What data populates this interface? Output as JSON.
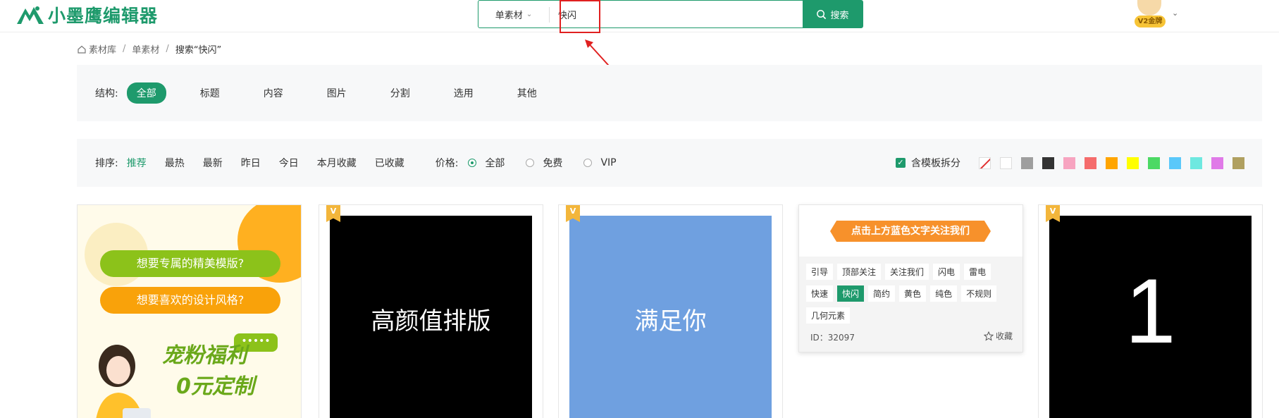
{
  "header": {
    "logo_text": "小墨鹰编辑器",
    "search": {
      "category": "单素材",
      "query": "快闪",
      "button": "搜索"
    },
    "user_badge": "V2金牌"
  },
  "breadcrumb": {
    "items": [
      "素材库",
      "单素材"
    ],
    "current": "搜索“快闪”"
  },
  "structure": {
    "label": "结构:",
    "options": [
      "全部",
      "标题",
      "内容",
      "图片",
      "分割",
      "选用",
      "其他"
    ],
    "active": "全部"
  },
  "sort": {
    "label": "排序:",
    "options": [
      "推荐",
      "最热",
      "最新",
      "昨日",
      "今日",
      "本月收藏",
      "已收藏"
    ],
    "active": "推荐"
  },
  "price": {
    "label": "价格:",
    "options": [
      "全部",
      "免费",
      "VIP"
    ],
    "selected": "全部"
  },
  "template_split": {
    "label": "含模板拆分",
    "checked": true
  },
  "colors": [
    "none",
    "#ffffff",
    "#9e9e9e",
    "#333333",
    "#f7a4c0",
    "#f56c6c",
    "#ffa500",
    "#ffff00",
    "#4cd964",
    "#5ac8fa",
    "#6ee8e0",
    "#e07ae8",
    "#b0a060"
  ],
  "cards": [
    {
      "type": "promo",
      "pill1": "想要专属的精美模版?",
      "pill2": "想要喜欢的设计风格?",
      "headline1": "宠粉福利",
      "headline2": "0元定制",
      "bubble": "•••••"
    },
    {
      "type": "text",
      "vip": true,
      "bg": "black",
      "text": "高颜值排版"
    },
    {
      "type": "text",
      "vip": true,
      "bg": "blue",
      "text": "满足你"
    },
    {
      "type": "tags",
      "ribbon": "点击上方蓝色文字关注我们",
      "tags": [
        "引导",
        "顶部关注",
        "关注我们",
        "闪电",
        "雷电",
        "快速",
        "快闪",
        "简约",
        "黄色",
        "纯色",
        "不规则",
        "几何元素"
      ],
      "active_tag": "快闪",
      "id_text": "ID：32097",
      "fav_label": "收藏"
    },
    {
      "type": "number",
      "vip": true,
      "bg": "black",
      "text": "1"
    }
  ],
  "vip_badge_text": "V"
}
